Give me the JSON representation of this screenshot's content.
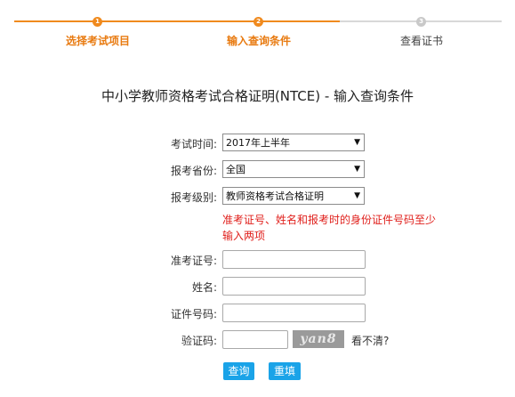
{
  "steps": [
    {
      "num": "1",
      "label": "选择考试项目",
      "active": true
    },
    {
      "num": "2",
      "label": "输入查询条件",
      "active": true
    },
    {
      "num": "3",
      "label": "查看证书",
      "active": false
    }
  ],
  "page_title": "中小学教师资格考试合格证明(NTCE) - 输入查询条件",
  "form": {
    "exam_time": {
      "label": "考试时间:",
      "value": "2017年上半年"
    },
    "province": {
      "label": "报考省份:",
      "value": "全国"
    },
    "level": {
      "label": "报考级别:",
      "value": "教师资格考试合格证明"
    },
    "hint": "准考证号、姓名和报考时的身份证件号码至少输入两项",
    "ticket_no": {
      "label": "准考证号:",
      "value": ""
    },
    "name": {
      "label": "姓名:",
      "value": ""
    },
    "id_no": {
      "label": "证件号码:",
      "value": ""
    },
    "captcha": {
      "label": "验证码:",
      "value": "",
      "image_text": "yan8",
      "refresh_link": "看不清?"
    }
  },
  "buttons": {
    "query": "查询",
    "reset": "重填"
  },
  "colors": {
    "accent": "#f08a1e",
    "error": "#e0201c",
    "button": "#1aa3e8"
  }
}
